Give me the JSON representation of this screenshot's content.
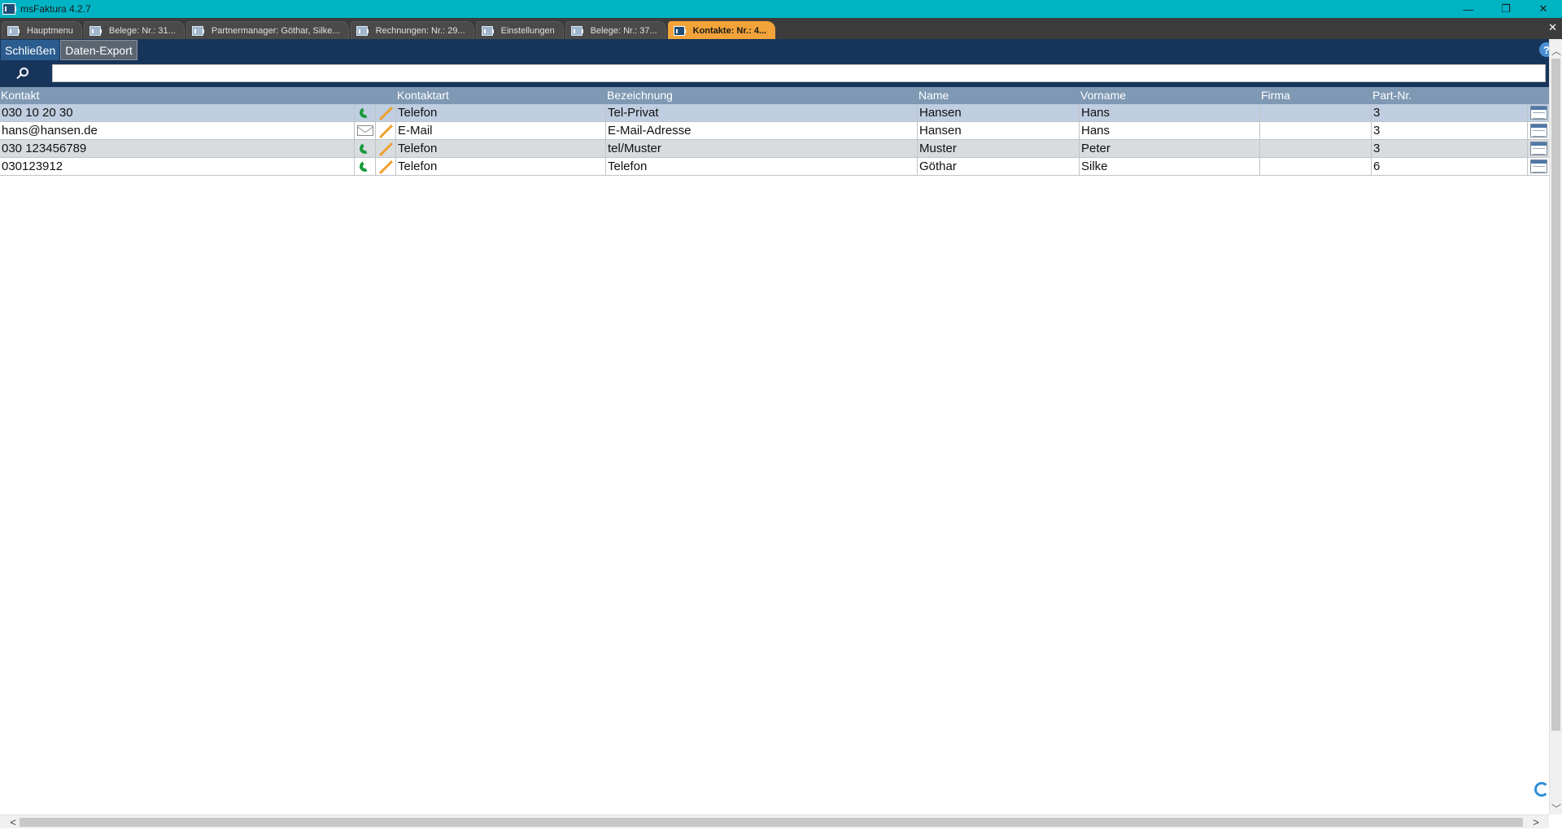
{
  "window": {
    "title": "msFaktura 4.2.7",
    "minimize_glyph": "—",
    "restore_glyph": "❐",
    "close_glyph": "✕"
  },
  "tabs": [
    {
      "label": "Hauptmenu",
      "active": false
    },
    {
      "label": "Belege: Nr.: 31...",
      "active": false
    },
    {
      "label": "Partnermanager: Göthar, Silke...",
      "active": false
    },
    {
      "label": "Rechnungen: Nr.: 29...",
      "active": false
    },
    {
      "label": "Einstellungen",
      "active": false
    },
    {
      "label": "Belege: Nr.: 37...",
      "active": false
    },
    {
      "label": "Kontakte: Nr.: 4...",
      "active": true
    }
  ],
  "tabstrip_close_glyph": "✕",
  "toolbar": {
    "close_label": "Schließen",
    "export_label": "Daten-Export",
    "help_glyph": "?"
  },
  "search": {
    "value": "",
    "placeholder": ""
  },
  "grid": {
    "columns": [
      "Kontakt",
      "",
      "",
      "Kontaktart",
      "Bezeichnung",
      "Name",
      "Vorname",
      "Firma",
      "Part-Nr.",
      ""
    ],
    "rows": [
      {
        "kontakt": "030 10 20 30",
        "type_icon": "phone-icon",
        "kontaktart": "Telefon",
        "bezeichnung": "Tel-Privat",
        "name": "Hansen",
        "vorname": "Hans",
        "firma": "",
        "part_nr": "3"
      },
      {
        "kontakt": "hans@hansen.de",
        "type_icon": "mail-icon",
        "kontaktart": "E-Mail",
        "bezeichnung": "E-Mail-Adresse",
        "name": "Hansen",
        "vorname": "Hans",
        "firma": "",
        "part_nr": "3"
      },
      {
        "kontakt": "030 123456789",
        "type_icon": "phone-icon",
        "kontaktart": "Telefon",
        "bezeichnung": "tel/Muster",
        "name": "Muster",
        "vorname": "Peter",
        "firma": "",
        "part_nr": "3"
      },
      {
        "kontakt": "030123912",
        "type_icon": "phone-icon",
        "kontaktart": "Telefon",
        "bezeichnung": "Telefon",
        "name": "Göthar",
        "vorname": "Silke",
        "firma": "",
        "part_nr": "6"
      }
    ]
  },
  "scrollbars": {
    "up_glyph": "︿",
    "down_glyph": "﹀",
    "left_glyph": "<",
    "right_glyph": ">"
  },
  "colors": {
    "titlebar": "#00b4c4",
    "active_tab": "#f2a33a",
    "toolbar": "#17355a",
    "grid_header": "#7f98b3",
    "selected_row": "#bfcee0"
  }
}
